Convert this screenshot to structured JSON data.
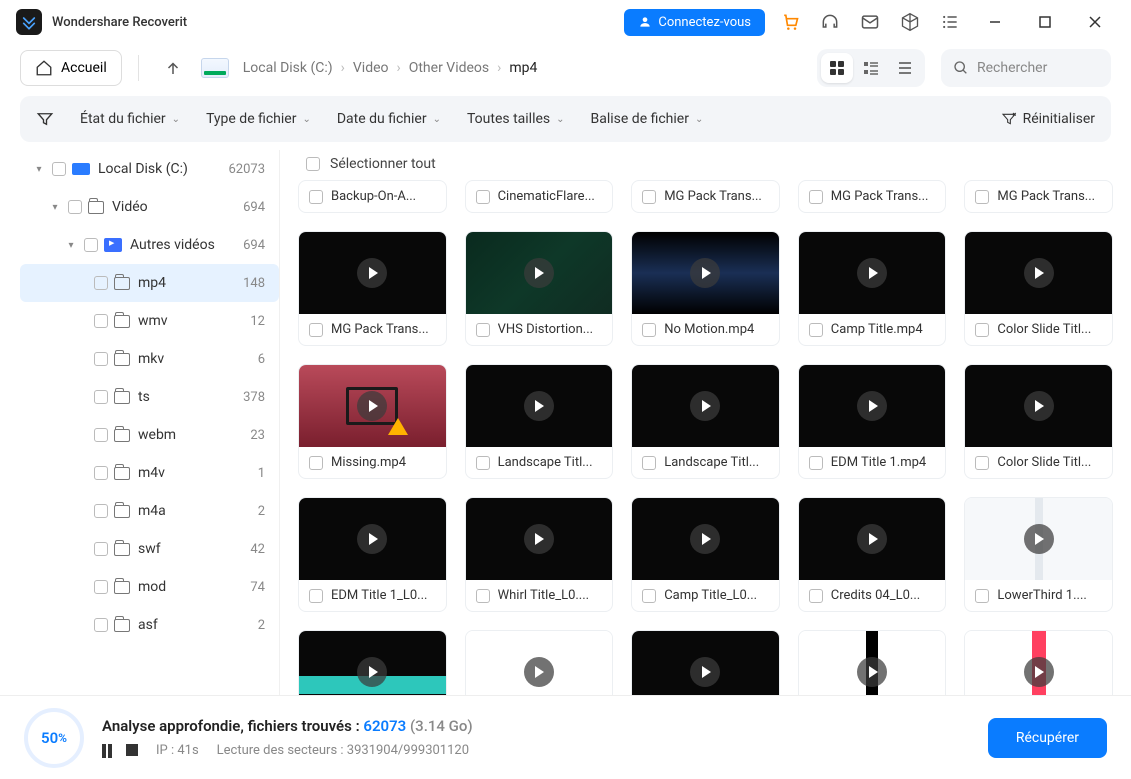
{
  "app": {
    "title": "Wondershare Recoverit",
    "connect": "Connectez-vous"
  },
  "toolbar": {
    "home": "Accueil"
  },
  "breadcrumb": {
    "disk": "Local Disk (C:)",
    "video": "Video",
    "other": "Other Videos",
    "mp4": "mp4"
  },
  "search": {
    "placeholder": "Rechercher"
  },
  "filters": {
    "state": "État du fichier",
    "type": "Type de fichier",
    "date": "Date du fichier",
    "size": "Toutes tailles",
    "tag": "Balise de fichier",
    "reset": "Réinitialiser"
  },
  "tree": {
    "root": {
      "label": "Local Disk (C:)",
      "count": "62073"
    },
    "video": {
      "label": "Vidéo",
      "count": "694"
    },
    "other": {
      "label": "Autres vidéos",
      "count": "694"
    },
    "items": [
      {
        "label": "mp4",
        "count": "148"
      },
      {
        "label": "wmv",
        "count": "12"
      },
      {
        "label": "mkv",
        "count": "6"
      },
      {
        "label": "ts",
        "count": "378"
      },
      {
        "label": "webm",
        "count": "23"
      },
      {
        "label": "m4v",
        "count": "1"
      },
      {
        "label": "m4a",
        "count": "2"
      },
      {
        "label": "swf",
        "count": "42"
      },
      {
        "label": "mod",
        "count": "74"
      },
      {
        "label": "asf",
        "count": "2"
      }
    ]
  },
  "content": {
    "select_all": "Sélectionner tout",
    "row0": [
      {
        "name": "Backup-On-A..."
      },
      {
        "name": "CinematicFlare..."
      },
      {
        "name": "MG Pack Trans..."
      },
      {
        "name": "MG Pack Trans..."
      },
      {
        "name": "MG Pack Trans..."
      }
    ],
    "row1": [
      {
        "name": "MG Pack Trans...",
        "t": ""
      },
      {
        "name": "VHS Distortion...",
        "t": "vhs"
      },
      {
        "name": "No Motion.mp4",
        "t": "motion"
      },
      {
        "name": "Camp Title.mp4",
        "t": ""
      },
      {
        "name": "Color Slide Titl...",
        "t": ""
      }
    ],
    "row2": [
      {
        "name": "Missing.mp4",
        "t": "missing"
      },
      {
        "name": "Landscape Titl...",
        "t": ""
      },
      {
        "name": "Landscape Titl...",
        "t": ""
      },
      {
        "name": "EDM Title 1.mp4",
        "t": ""
      },
      {
        "name": "Color Slide Titl...",
        "t": ""
      }
    ],
    "row3": [
      {
        "name": "EDM Title 1_L0...",
        "t": ""
      },
      {
        "name": "Whirl Title_L0....",
        "t": ""
      },
      {
        "name": "Camp Title_L0...",
        "t": ""
      },
      {
        "name": "Credits 04_L0...",
        "t": ""
      },
      {
        "name": "LowerThird 1....",
        "t": "light"
      }
    ],
    "row4": [
      {
        "name": "",
        "t": "teal"
      },
      {
        "name": "",
        "t": "white"
      },
      {
        "name": "",
        "t": ""
      },
      {
        "name": "",
        "t": "white-strip"
      },
      {
        "name": "",
        "t": "white-red"
      }
    ]
  },
  "footer": {
    "percent": "50",
    "title_prefix": "Analyse approfondie, fichiers trouvés : ",
    "found": "62073",
    "size": "(3.14 Go)",
    "ip": "IP : 41s",
    "sectors": "Lecture des secteurs : 3931904/999301120",
    "recover": "Récupérer"
  }
}
